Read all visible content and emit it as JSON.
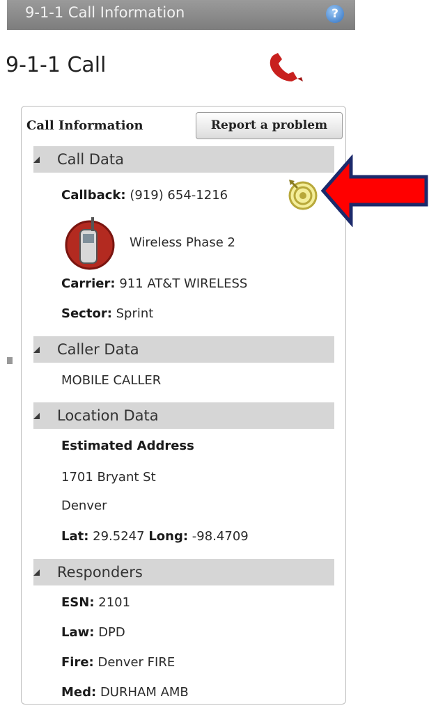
{
  "window": {
    "title": "9-1-1 Call Information"
  },
  "page": {
    "title": "9-1-1 Call"
  },
  "panel": {
    "heading": "Call Information",
    "report_button": "Report a problem"
  },
  "sections": {
    "call_data": {
      "label": "Call Data",
      "callback_label": "Callback:",
      "callback_value": "(919) 654-1216",
      "service_type": "Wireless Phase 2",
      "carrier_label": "Carrier:",
      "carrier_value": "911 AT&T WIRELESS",
      "sector_label": "Sector:",
      "sector_value": "Sprint"
    },
    "caller_data": {
      "label": "Caller Data",
      "caller_value": "MOBILE CALLER"
    },
    "location_data": {
      "label": "Location Data",
      "address_heading": "Estimated Address",
      "street": "1701 Bryant St",
      "city": "Denver",
      "lat_label": "Lat:",
      "lat_value": "29.5247",
      "long_label": "Long:",
      "long_value": "-98.4709"
    },
    "responders": {
      "label": "Responders",
      "esn_label": "ESN:",
      "esn_value": "2101",
      "law_label": "Law:",
      "law_value": "DPD",
      "fire_label": "Fire:",
      "fire_value": "Denver FIRE",
      "med_label": "Med:",
      "med_value": "DURHAM AMB"
    }
  },
  "icons": {
    "help": "help-icon",
    "phone": "phone-handset-icon",
    "wireless": "cell-phone-icon",
    "callback": "rebid-target-icon",
    "annotation": "red-arrow-icon"
  },
  "colors": {
    "title_bar": "#8a8a8a",
    "section_bar": "#d6d6d6",
    "phone_red": "#c8201e",
    "arrow_red": "#ff0000",
    "arrow_outline": "#1c2a6b"
  }
}
